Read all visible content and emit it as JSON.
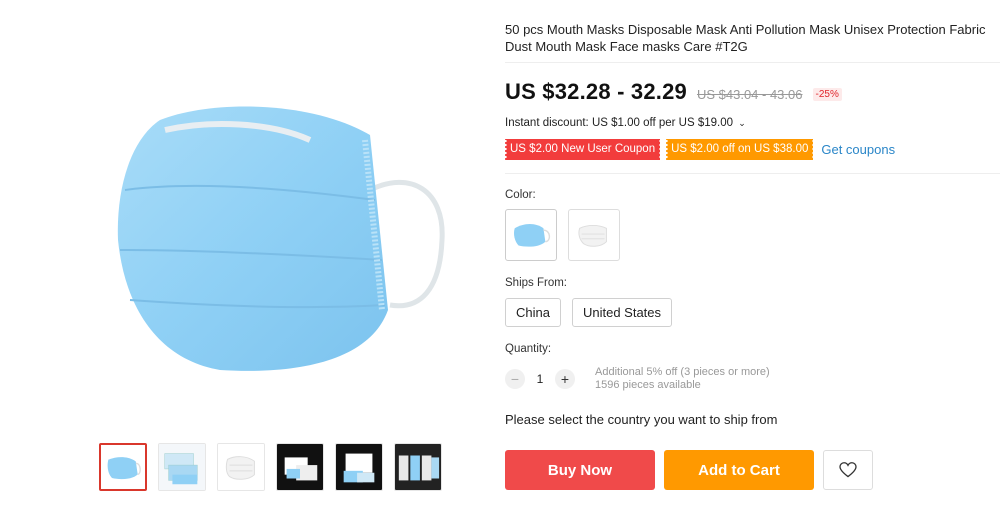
{
  "product": {
    "title": "50 pcs Mouth Masks Disposable Mask Anti Pollution Mask Unisex Protection Fabric Dust Mouth Mask Face masks Care #T2G",
    "price": "US $32.28 - 32.29",
    "original_price": "US $43.04 - 43.06",
    "discount": "-25%",
    "instant_discount": "Instant discount: US $1.00 off per US $19.00",
    "instant_chevron": "⌄"
  },
  "coupons": {
    "new_user": "US $2.00 New User Coupon",
    "store": "US $2.00 off on US $38.00",
    "get_coupons_label": "Get coupons"
  },
  "color": {
    "label": "Color:",
    "options": [
      "blue",
      "white"
    ]
  },
  "ships_from": {
    "label": "Ships From:",
    "options": [
      "China",
      "United States"
    ]
  },
  "quantity": {
    "label": "Quantity:",
    "value": "1",
    "minus": "−",
    "plus": "+",
    "additional_offer": "Additional 5% off (3 pieces or more)",
    "available": "1596 pieces available"
  },
  "ship_notice": "Please select the country you want to ship from",
  "actions": {
    "buy_now": "Buy Now",
    "add_to_cart": "Add to Cart"
  },
  "colors": {
    "buy_now": "#f04a4a",
    "add_to_cart": "#ff9900",
    "coupon_red": "#f23c3c",
    "coupon_orange": "#ff9900",
    "link": "#2a86c8",
    "mask_blue": "#8fd0f5"
  },
  "gallery": {
    "thumbnails": [
      "blue-mask",
      "stack-of-masks",
      "white-mask",
      "boxed-masks-dark",
      "box-with-blue-masks",
      "mask-packs-row"
    ],
    "active_index": 0
  }
}
